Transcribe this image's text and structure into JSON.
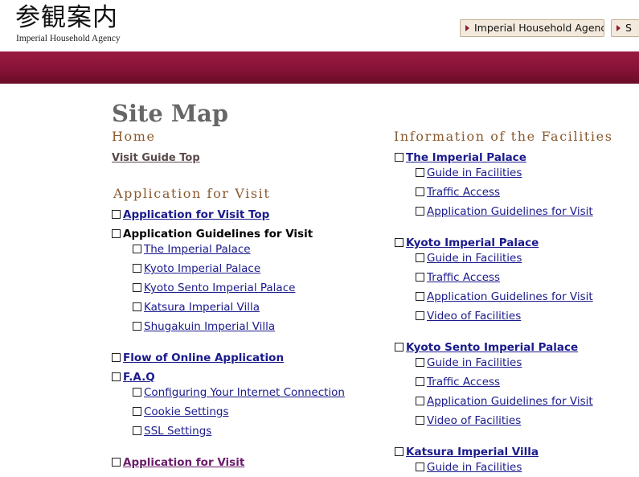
{
  "header": {
    "logo_jp": "参観案内",
    "logo_en": "Imperial Household Agency",
    "buttons": [
      "Imperial Household Agency",
      "S"
    ]
  },
  "page_title": "Site Map",
  "left": {
    "home_heading": "Home",
    "home_link": "Visit Guide Top",
    "app_heading": "Application for Visit",
    "items": [
      "Application for Visit Top",
      "Application Guidelines for Visit",
      "The Imperial Palace",
      "Kyoto Imperial Palace",
      "Kyoto Sento Imperial Palace",
      "Katsura Imperial Villa",
      "Shugakuin Imperial Villa",
      "Flow of Online Application",
      "F.A.Q",
      "Configuring Your Internet Connection",
      "Cookie Settings",
      "SSL Settings",
      "Application for Visit"
    ]
  },
  "right": {
    "heading": "Information of the Facilities",
    "items": [
      "The Imperial Palace",
      "Guide in Facilities",
      "Traffic Access",
      "Application Guidelines for Visit",
      "Kyoto Imperial Palace",
      "Guide in Facilities",
      "Traffic Access",
      "Application Guidelines for Visit",
      "Video of Facilities",
      "Kyoto Sento Imperial Palace",
      "Guide in Facilities",
      "Traffic Access",
      "Application Guidelines for Visit",
      "Video of Facilities",
      "Katsura Imperial Villa",
      "Guide in Facilities"
    ]
  }
}
